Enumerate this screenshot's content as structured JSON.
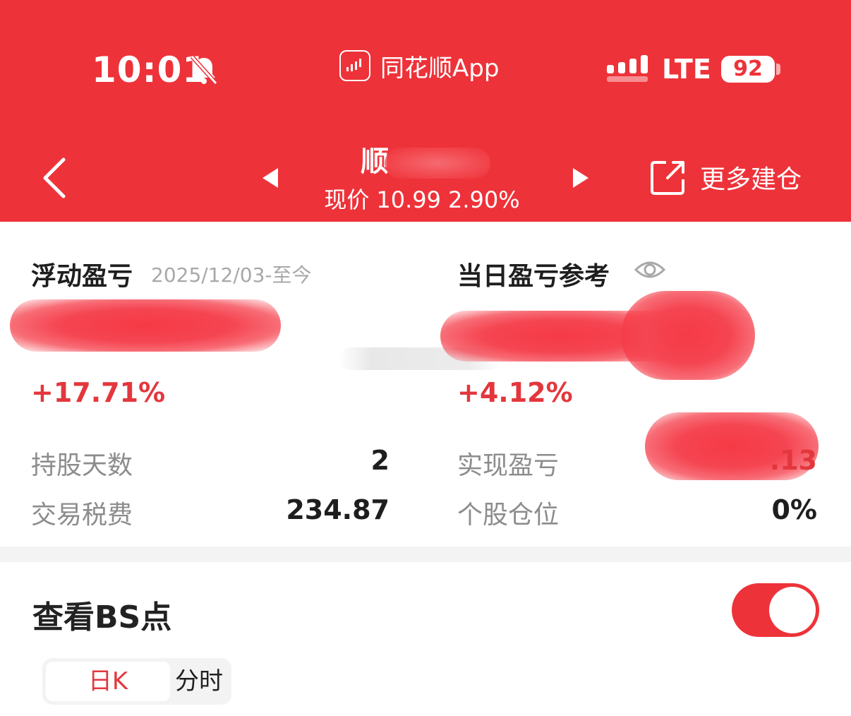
{
  "status_bar": {
    "time": "10:01",
    "app_name": "同花顺App",
    "network": "LTE",
    "battery": "92"
  },
  "nav": {
    "title": "顺",
    "price_label": "现价",
    "price": "10.99",
    "change_pct": "2.90%",
    "more_label": "更多建仓"
  },
  "summary": {
    "floating_pnl_label": "浮动盈亏",
    "floating_pnl_period": "2025/12/03-至今",
    "floating_pnl_pct": "+17.71%",
    "daily_pnl_label": "当日盈亏参考",
    "daily_pnl_pct": "+4.12%",
    "holding_days_label": "持股天数",
    "holding_days": "2",
    "fees_label": "交易税费",
    "fees": "234.87",
    "realized_pnl_label": "实现盈亏",
    "realized_pnl_visible": ".13",
    "position_label": "个股仓位",
    "position": "0%"
  },
  "bs_section": {
    "title": "查看BS点",
    "toggle_on": true,
    "tabs": [
      "日K",
      "分时"
    ]
  },
  "colors": {
    "brand_red": "#ee3239",
    "gain_red": "#e3373d"
  }
}
